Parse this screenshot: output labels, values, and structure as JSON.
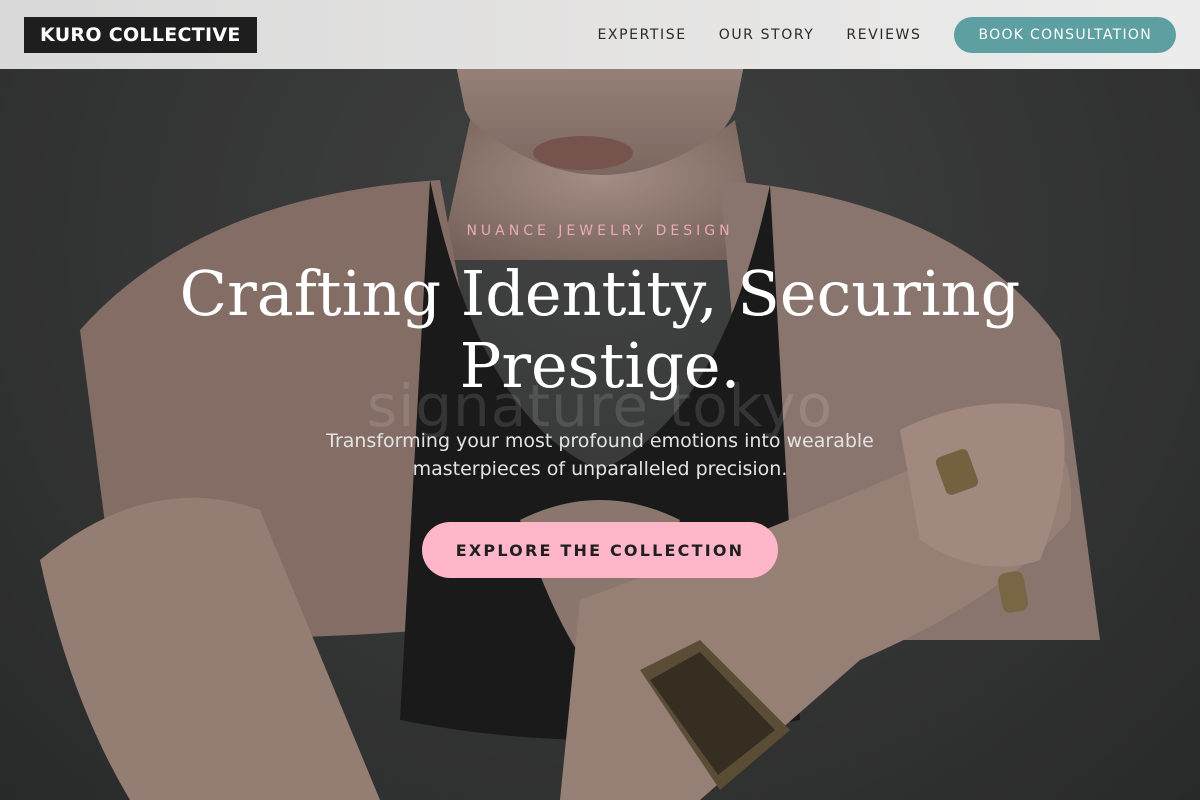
{
  "brand": {
    "logo_text": "KURO COLLECTIVE"
  },
  "nav": {
    "items": [
      {
        "label": "EXPERTISE"
      },
      {
        "label": "OUR STORY"
      },
      {
        "label": "REVIEWS"
      }
    ],
    "cta_label": "BOOK CONSULTATION"
  },
  "hero": {
    "eyebrow": "NUANCE JEWELRY DESIGN",
    "headline": "Crafting Identity, Securing Prestige.",
    "subtext": "Transforming your most profound emotions into wearable masterpieces of unparalleled precision.",
    "cta_label": "EXPLORE THE COLLECTION",
    "watermark": "signature tokyo"
  },
  "colors": {
    "header_bg": "#e4e3e2",
    "logo_bg": "#1e1e1e",
    "teal_accent": "#5e9fa1",
    "pink_accent": "#ffb6c8",
    "eyebrow_pink": "#e8a9b8"
  }
}
